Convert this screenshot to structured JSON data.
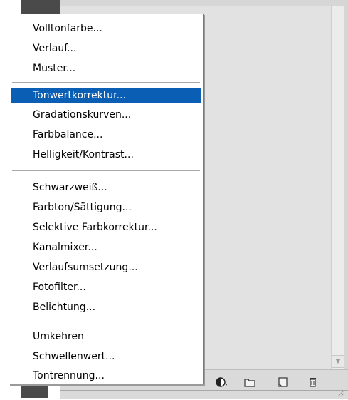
{
  "menu": {
    "groups": [
      [
        "Volltonfarbe...",
        "Verlauf...",
        "Muster..."
      ],
      [
        "Tonwertkorrektur...",
        "Gradationskurven...",
        "Farbbalance...",
        "Helligkeit/Kontrast..."
      ],
      [
        "Schwarzweiß...",
        "Farbton/Sättigung...",
        "Selektive Farbkorrektur...",
        "Kanalmixer...",
        "Verlaufsumsetzung...",
        "Fotofilter...",
        "Belichtung..."
      ],
      [
        "Umkehren",
        "Schwellenwert...",
        "Tontrennung..."
      ]
    ],
    "selected_item": "Tonwertkorrektur...",
    "selection_color": "#0a5fb4"
  },
  "panel_toolbar": {
    "icons": [
      "adjustment-layer-icon",
      "new-group-icon",
      "new-layer-icon",
      "trash-icon"
    ]
  }
}
